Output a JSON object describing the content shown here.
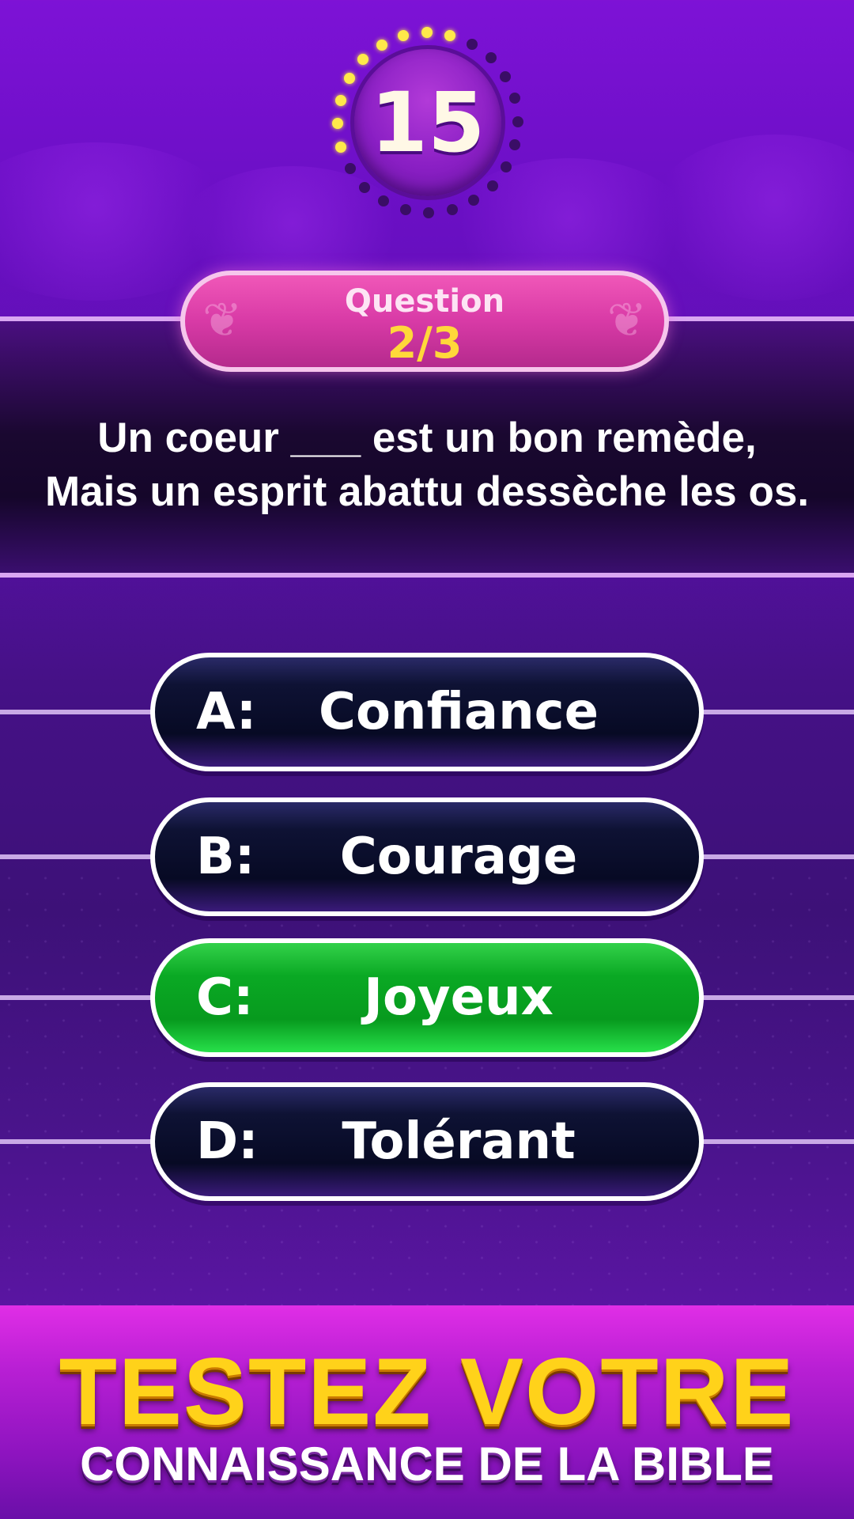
{
  "timer": {
    "seconds_left": "15"
  },
  "question": {
    "label": "Question",
    "count": "2/3",
    "line1": "Un coeur ___ est un bon remède,",
    "line2": "Mais un esprit abattu dessèche les os."
  },
  "answers": [
    {
      "letter": "A:",
      "text": "Confiance",
      "state": "default"
    },
    {
      "letter": "B:",
      "text": "Courage",
      "state": "default"
    },
    {
      "letter": "C:",
      "text": "Joyeux",
      "state": "correct"
    },
    {
      "letter": "D:",
      "text": "Tolérant",
      "state": "default"
    }
  ],
  "promo": {
    "title": "TESTEZ VOTRE",
    "subtitle": "CONNAISSANCE DE LA BIBLE"
  },
  "colors": {
    "correct": "#0aa924",
    "badge": "#d83aa6",
    "count": "#ffd83a",
    "timer_on": "#ffe94a"
  }
}
